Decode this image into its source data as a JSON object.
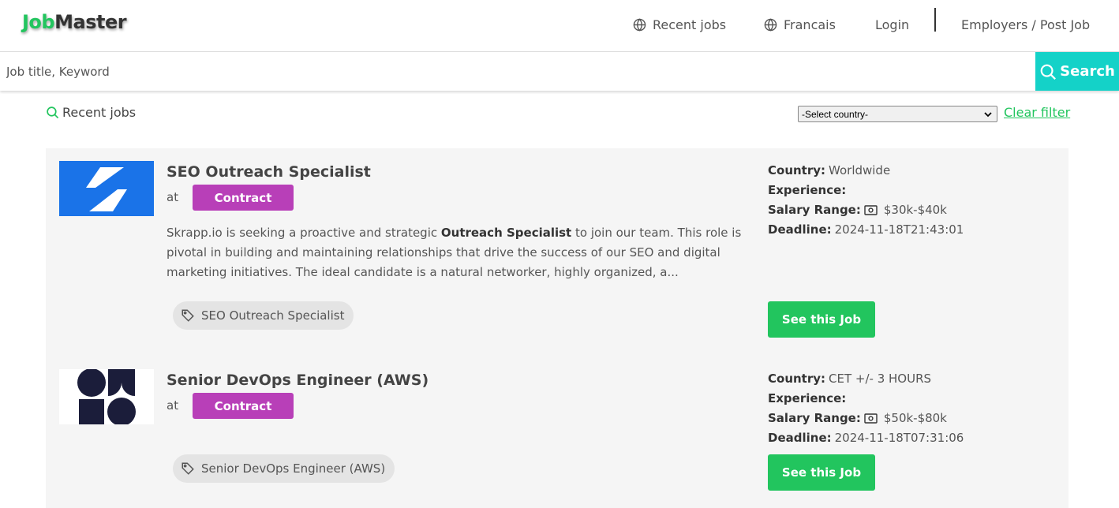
{
  "header": {
    "logo_part1": "Job",
    "logo_part2": "Master",
    "nav": {
      "recent_jobs": "Recent jobs",
      "language": "Francais",
      "login": "Login",
      "employers": "Employers / Post Job"
    }
  },
  "search": {
    "placeholder": "Job title, Keyword",
    "value": "",
    "button_label": "Search"
  },
  "filters": {
    "heading": "Recent jobs",
    "country_select_value": "-Select country-",
    "clear_label": "Clear filter"
  },
  "colors": {
    "brand_green": "#22c55e",
    "search_teal": "#14d2c8",
    "badge_purple": "#b83fb8"
  },
  "jobs": [
    {
      "title": "SEO Outreach Specialist",
      "at": "at",
      "type": "Contract",
      "logo_icon": "skrapp-logo",
      "description_before": "Skrapp.io is seeking a proactive and strategic ",
      "description_bold": "Outreach Specialist",
      "description_after": " to join our team. This role is pivotal in building and maintaining relationships that drive the success of our SEO and digital marketing initiatives. The ideal candidate is a natural networker, highly organized, a...",
      "tag": "SEO Outreach Specialist",
      "country_label": "Country:",
      "country": "Worldwide",
      "experience_label": "Experience:",
      "experience": "",
      "salary_label": "Salary Range:",
      "salary": "$30k-$40k",
      "deadline_label": "Deadline:",
      "deadline": "2024-11-18T21:43:01",
      "button": "See this Job"
    },
    {
      "title": "Senior DevOps Engineer (AWS)",
      "at": "at",
      "type": "Contract",
      "logo_icon": "shapes-logo",
      "tag": "Senior DevOps Engineer (AWS)",
      "country_label": "Country:",
      "country": "CET +/- 3 HOURS",
      "experience_label": "Experience:",
      "experience": "",
      "salary_label": "Salary Range:",
      "salary": "$50k-$80k",
      "deadline_label": "Deadline:",
      "deadline": "2024-11-18T07:31:06",
      "button": "See this Job"
    }
  ]
}
